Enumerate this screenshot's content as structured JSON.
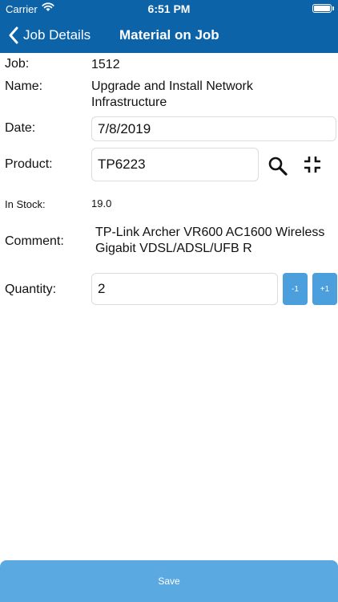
{
  "status": {
    "carrier": "Carrier",
    "time": "6:51 PM",
    "battery_level": 1.0
  },
  "nav": {
    "back_label": "Job Details",
    "title": "Material on Job"
  },
  "form": {
    "job_label": "Job:",
    "job_value": "1512",
    "name_label": "Name:",
    "name_value_line1": "Upgrade and Install Network",
    "name_value_line2": "Infrastructure",
    "date_label": "Date:",
    "date_value": "7/8/2019",
    "product_label": "Product:",
    "product_value": "TP6223",
    "stock_label": "In Stock:",
    "stock_value": "19.0",
    "comment_label": "Comment:",
    "comment_line1": "TP-Link Archer VR600 AC1600 Wireless",
    "comment_line2": "Gigabit VDSL/ADSL/UFB R",
    "quantity_label": "Quantity:",
    "quantity_value": "2",
    "decrement_label": "-1",
    "increment_label": "+1"
  },
  "footer": {
    "save_label": "Save"
  },
  "colors": {
    "header_bg": "#0d63a8",
    "button_bg": "#4a9fdc",
    "save_bg": "#5aa9e0"
  },
  "icons": [
    "wifi-icon",
    "battery-icon",
    "chevron-left-icon",
    "search-icon",
    "collapse-icon"
  ]
}
